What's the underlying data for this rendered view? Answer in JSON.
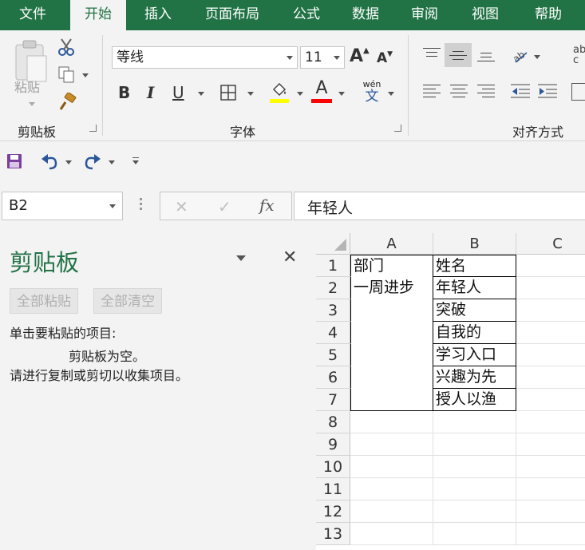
{
  "menu": {
    "tabs": [
      "文件",
      "开始",
      "插入",
      "页面布局",
      "公式",
      "数据",
      "审阅",
      "视图",
      "帮助"
    ],
    "active": "开始"
  },
  "ribbon": {
    "clipboard": {
      "paste_label": "粘贴",
      "group_label": "剪贴板"
    },
    "font": {
      "font_name": "等线",
      "font_size": "11",
      "grow": "A",
      "shrink": "A",
      "bold": "B",
      "italic": "I",
      "underline": "U",
      "font_color_glyph": "A",
      "fill_color": "#ffff00",
      "font_color": "#ff0000",
      "phonetic_top": "wén",
      "phonetic_bottom": "文",
      "group_label": "字体"
    },
    "alignment": {
      "group_label": "对齐方式",
      "wrap_glyph": "ab c"
    }
  },
  "formula_bar": {
    "name_box": "B2",
    "fx": "fx",
    "content": "年轻人"
  },
  "clipboard_pane": {
    "title": "剪贴板",
    "paste_all": "全部粘贴",
    "clear_all": "全部清空",
    "instruction": "单击要粘贴的项目:",
    "empty_line1": "剪贴板为空。",
    "empty_line2": "请进行复制或剪切以收集项目。"
  },
  "sheet": {
    "columns": [
      "A",
      "B",
      "C"
    ],
    "rows": [
      "1",
      "2",
      "3",
      "4",
      "5",
      "6",
      "7",
      "8",
      "9",
      "10",
      "11",
      "12",
      "13"
    ],
    "cells_a": [
      "部门",
      "一周进步",
      "",
      "",
      "",
      "",
      ""
    ],
    "cells_b": [
      "姓名",
      "年轻人",
      "突破",
      "自我的",
      "学习入口",
      "兴趣为先",
      "授人以渔"
    ]
  },
  "colors": {
    "accent": "#217346"
  }
}
